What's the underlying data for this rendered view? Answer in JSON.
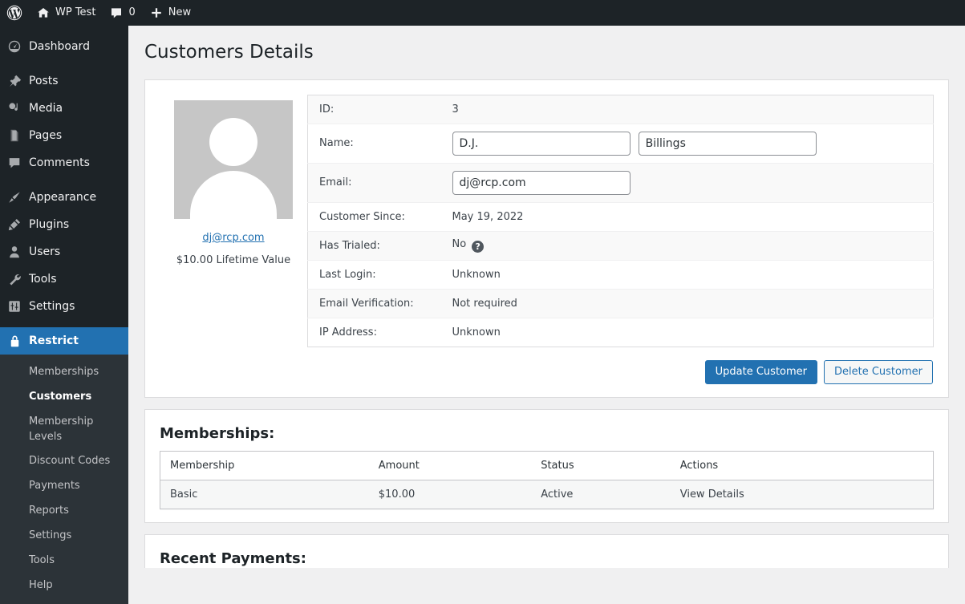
{
  "adminbar": {
    "logo_icon": "wordpress-logo-icon",
    "site": {
      "icon": "home-icon",
      "label": "WP Test"
    },
    "comments": {
      "icon": "comment-bubble-icon",
      "count": "0"
    },
    "new": {
      "icon": "plus-icon",
      "label": "New"
    }
  },
  "sidebar": {
    "top_items": [
      {
        "label": "Dashboard",
        "icon": "dashboard-icon",
        "current": false
      },
      {
        "label": "Posts",
        "icon": "pin-icon",
        "current": false
      },
      {
        "label": "Media",
        "icon": "media-icon",
        "current": false
      },
      {
        "label": "Pages",
        "icon": "pages-icon",
        "current": false
      },
      {
        "label": "Comments",
        "icon": "comment-bubble-icon",
        "current": false
      },
      {
        "label": "Appearance",
        "icon": "paintbrush-icon",
        "current": false
      },
      {
        "label": "Plugins",
        "icon": "plug-icon",
        "current": false
      },
      {
        "label": "Users",
        "icon": "user-icon",
        "current": false
      },
      {
        "label": "Tools",
        "icon": "wrench-icon",
        "current": false
      },
      {
        "label": "Settings",
        "icon": "settings-sliders-icon",
        "current": false
      },
      {
        "label": "Restrict",
        "icon": "lock-icon",
        "current": true
      }
    ],
    "submenu": [
      {
        "label": "Memberships",
        "current": false
      },
      {
        "label": "Customers",
        "current": true
      },
      {
        "label": "Membership Levels",
        "current": false
      },
      {
        "label": "Discount Codes",
        "current": false
      },
      {
        "label": "Payments",
        "current": false
      },
      {
        "label": "Reports",
        "current": false
      },
      {
        "label": "Settings",
        "current": false
      },
      {
        "label": "Tools",
        "current": false
      },
      {
        "label": "Help",
        "current": false
      }
    ]
  },
  "page": {
    "title": "Customers Details"
  },
  "customer": {
    "avatar_icon": "default-avatar-icon",
    "email_link": "dj@rcp.com",
    "lifetime_value": "$10.00 Lifetime Value",
    "fields": {
      "id_label": "ID:",
      "id_value": "3",
      "name_label": "Name:",
      "first_name": "D.J.",
      "last_name": "Billings",
      "email_label": "Email:",
      "email_value": "dj@rcp.com",
      "customer_since_label": "Customer Since:",
      "customer_since_value": "May 19, 2022",
      "has_trialed_label": "Has Trialed:",
      "has_trialed_value": "No",
      "has_trialed_help_icon": "question-mark-icon",
      "last_login_label": "Last Login:",
      "last_login_value": "Unknown",
      "email_verification_label": "Email Verification:",
      "email_verification_value": "Not required",
      "ip_address_label": "IP Address:",
      "ip_address_value": "Unknown"
    },
    "buttons": {
      "update": "Update Customer",
      "delete": "Delete Customer"
    }
  },
  "memberships": {
    "heading": "Memberships:",
    "columns": [
      "Membership",
      "Amount",
      "Status",
      "Actions"
    ],
    "rows": [
      {
        "membership": "Basic",
        "amount": "$10.00",
        "status": "Active",
        "action": "View Details"
      }
    ]
  },
  "recent_payments": {
    "heading": "Recent Payments:"
  },
  "colors": {
    "accent": "#2271b1",
    "admin_bg": "#1d2327",
    "submenu_bg": "#2c3338",
    "page_bg": "#f0f0f1",
    "link": "#2271b1"
  }
}
